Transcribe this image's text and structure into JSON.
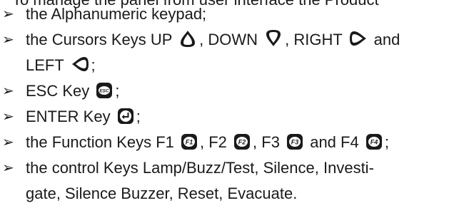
{
  "top_line": "To manage the panel from user interface the Product",
  "bullet_glyph": "➢",
  "items": {
    "keypad": "the Alphanumeric keypad;",
    "cursors": {
      "pre": "the Cursors Keys UP",
      "down": ", DOWN",
      "right": ", RIGHT",
      "and": "and",
      "left_word": "LEFT",
      "end": ";"
    },
    "esc": {
      "pre": "ESC Key",
      "key_label": "ESC",
      "end": ";"
    },
    "enter": {
      "pre": "ENTER Key",
      "end": ";"
    },
    "function": {
      "pre": "the Function Keys F1",
      "f2_pre": ", F2",
      "f3_pre": ", F3",
      "and_f4": "and F4",
      "end": ";",
      "f1_label": "F1",
      "f2_label": "F2",
      "f3_label": "F3",
      "f4_label": "F4"
    },
    "control": {
      "line1": "the control Keys Lamp/Buzz/Test, Silence, Investi-",
      "line2": "gate, Silence Buzzer, Reset, Evacuate."
    }
  },
  "icons": [
    "up-key-icon",
    "down-key-icon",
    "right-key-icon",
    "left-key-icon",
    "esc-key-icon",
    "enter-key-icon",
    "f1-key-icon",
    "f2-key-icon",
    "f3-key-icon",
    "f4-key-icon"
  ]
}
